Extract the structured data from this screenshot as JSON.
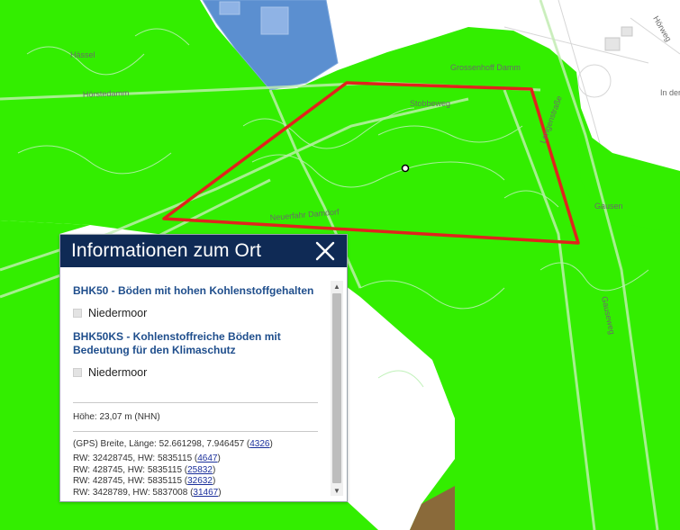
{
  "map": {
    "labels": {
      "road_1": "Hörstedamm",
      "road_2": "Grossenhoff Damm",
      "road_3": "Stobbeweg",
      "road_4": "Gausen",
      "road_5": "Lengenstraße",
      "road_6": "Neuerfahr Damdorf",
      "road_7": "Gauseweg",
      "area_1": "Hässel",
      "road_8": "Hörweg",
      "place_1": "In der"
    },
    "colors": {
      "soil_green": "#33ee00",
      "water_blue": "#5b8fd0",
      "parcel_outline": "#e0241c",
      "brown_area": "#8a6a3a"
    }
  },
  "info_panel": {
    "title": "Informationen zum Ort",
    "close_icon": "close-icon",
    "sections": [
      {
        "title": "BHK50 - Böden mit hohen Kohlenstoffgehalten",
        "legend": "Niedermoor"
      },
      {
        "title": "BHK50KS - Kohlenstoffreiche Böden mit Bedeutung für den Klimaschutz",
        "legend": "Niedermoor"
      }
    ],
    "height": "Höhe: 23,07 m (NHN)",
    "gps_prefix": "(GPS) Breite, Länge: 52.661298, 7.946457 (",
    "gps_epsg": "4326",
    "coords": [
      {
        "text": "RW: 32428745, HW: 5835115 (",
        "epsg": "4647"
      },
      {
        "text": "RW: 428745, HW: 5835115 (",
        "epsg": "25832"
      },
      {
        "text": "RW: 428745, HW: 5835115 (",
        "epsg": "32632"
      },
      {
        "text": "RW: 3428789, HW: 5837008 (",
        "epsg": "31467"
      }
    ]
  }
}
